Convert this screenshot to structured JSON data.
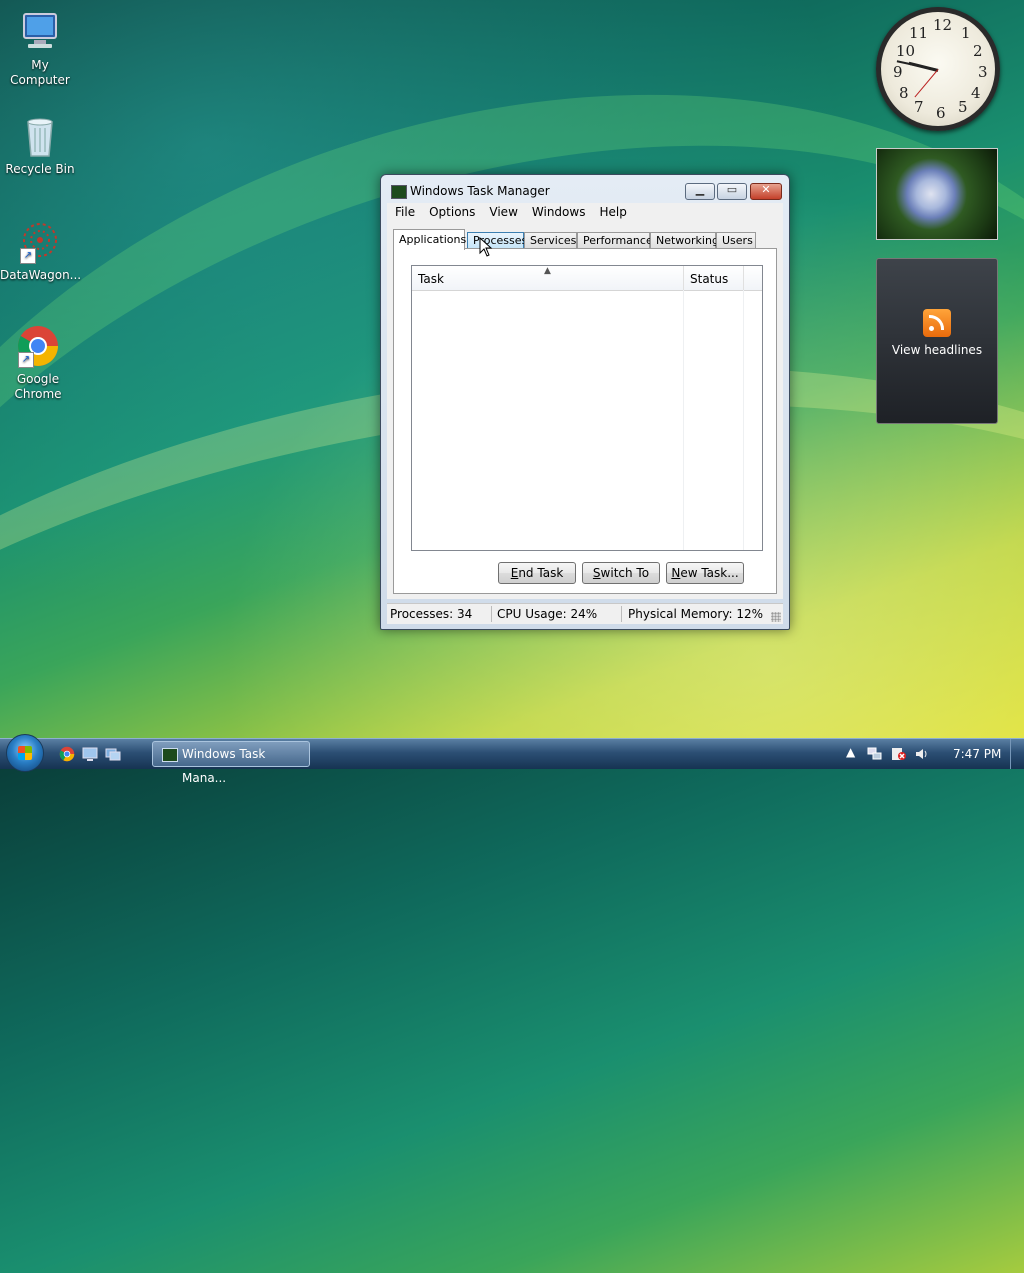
{
  "desktop": {
    "icons": [
      {
        "label": "My Computer"
      },
      {
        "label": "Recycle Bin"
      },
      {
        "label": "DataWagon..."
      },
      {
        "label": "Google Chrome"
      }
    ]
  },
  "gadgets": {
    "clock": {
      "numerals": [
        "12",
        "1",
        "2",
        "3",
        "4",
        "5",
        "6",
        "7",
        "8",
        "9",
        "10",
        "11"
      ],
      "time": "7:47"
    },
    "feed": {
      "label": "View headlines",
      "accent": "#f5821f"
    }
  },
  "window": {
    "title": "Windows Task Manager",
    "menu": [
      "File",
      "Options",
      "View",
      "Windows",
      "Help"
    ],
    "tabs": [
      {
        "label": "Applications",
        "active": true
      },
      {
        "label": "Processes",
        "hovered": true
      },
      {
        "label": "Services"
      },
      {
        "label": "Performance"
      },
      {
        "label": "Networking"
      },
      {
        "label": "Users"
      }
    ],
    "columns": [
      "Task",
      "Status"
    ],
    "rows": [],
    "buttons": {
      "end_task": {
        "mnemonic": "E",
        "rest": "nd Task"
      },
      "switch_to": {
        "mnemonic": "S",
        "rest": "witch To"
      },
      "new_task": {
        "mnemonic": "N",
        "rest": "ew Task..."
      }
    },
    "status": {
      "processes": "Processes: 34",
      "cpu": "CPU Usage: 24%",
      "memory": "Physical Memory: 12%"
    }
  },
  "taskbar": {
    "task_button": "Windows Task Mana...",
    "clock": "7:47 PM"
  }
}
